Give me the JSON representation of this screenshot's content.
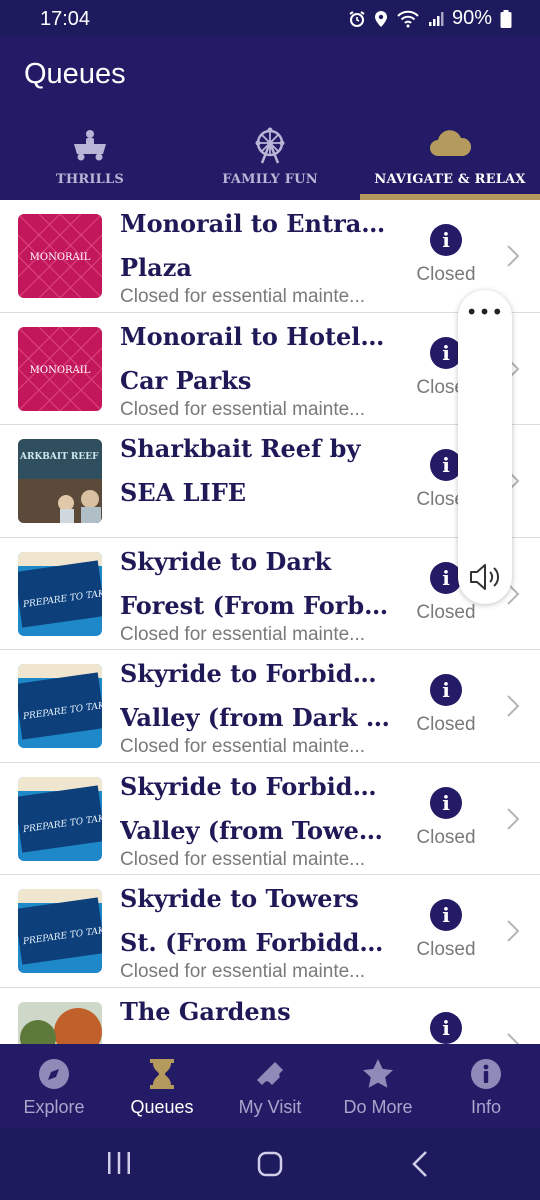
{
  "status_bar": {
    "time": "17:04",
    "battery": "90%"
  },
  "header": {
    "title": "Queues"
  },
  "tabs": [
    {
      "label": "THRILLS",
      "icon": "ride-car-icon"
    },
    {
      "label": "FAMILY FUN",
      "icon": "ferris-wheel-icon"
    },
    {
      "label": "NAVIGATE & RELAX",
      "icon": "cloud-icon",
      "active": true
    }
  ],
  "rows": [
    {
      "title_line1": "Monorail to Entrance",
      "title_line2": "Plaza",
      "subtitle": "Closed for essential mainte...",
      "status": "Closed",
      "thumb": "monorail",
      "thumb_text": "MONORAIL"
    },
    {
      "title_line1": "Monorail to Hotels &",
      "title_line2": "Car Parks",
      "subtitle": "Closed for essential mainte...",
      "status": "Closed",
      "thumb": "monorail",
      "thumb_text": "MONORAIL"
    },
    {
      "title_line1": "Sharkbait Reef by",
      "title_line2": "SEA LIFE",
      "subtitle": "",
      "status": "Closed",
      "thumb": "sharkbait",
      "thumb_text": "ARKBAIT REEF SEA LIFE AQUARIUM"
    },
    {
      "title_line1": "Skyride to Dark",
      "title_line2": "Forest (From Forbid...",
      "subtitle": "Closed for essential mainte...",
      "status": "Closed",
      "thumb": "skyride",
      "thumb_text": "PREPARE TO TAKE FLIGHT"
    },
    {
      "title_line1": "Skyride to Forbidden",
      "title_line2": "Valley (from Dark F...",
      "subtitle": "Closed for essential mainte...",
      "status": "Closed",
      "thumb": "skyride",
      "thumb_text": "PREPARE TO TAKE FLIGHT"
    },
    {
      "title_line1": "Skyride to Forbidden",
      "title_line2": "Valley (from Tower...",
      "subtitle": "Closed for essential mainte...",
      "status": "Closed",
      "thumb": "skyride",
      "thumb_text": "PREPARE TO TAKE FLIGHT"
    },
    {
      "title_line1": "Skyride to Towers",
      "title_line2": "St. (From Forbidden...",
      "subtitle": "Closed for essential mainte...",
      "status": "Closed",
      "thumb": "skyride",
      "thumb_text": "PREPARE TO TAKE FLIGHT"
    },
    {
      "title_line1": "",
      "title_line2": "The Gardens",
      "subtitle": "",
      "status": "",
      "thumb": "gardens",
      "thumb_text": ""
    }
  ],
  "side_panel": {
    "more_icon": "more-dots-icon",
    "volume_icon": "volume-icon"
  },
  "bottom_nav": [
    {
      "label": "Explore",
      "icon": "compass-icon"
    },
    {
      "label": "Queues",
      "icon": "hourglass-icon",
      "active": true
    },
    {
      "label": "My Visit",
      "icon": "ticket-icon"
    },
    {
      "label": "Do More",
      "icon": "star-icon"
    },
    {
      "label": "Info",
      "icon": "info-icon"
    }
  ],
  "colors": {
    "header_bg": "#241b66",
    "status_bg": "#1e1a5e",
    "tab_underline": "#b49a5c",
    "title_text": "#1f1a57",
    "monorail_pink": "#c2185b"
  }
}
